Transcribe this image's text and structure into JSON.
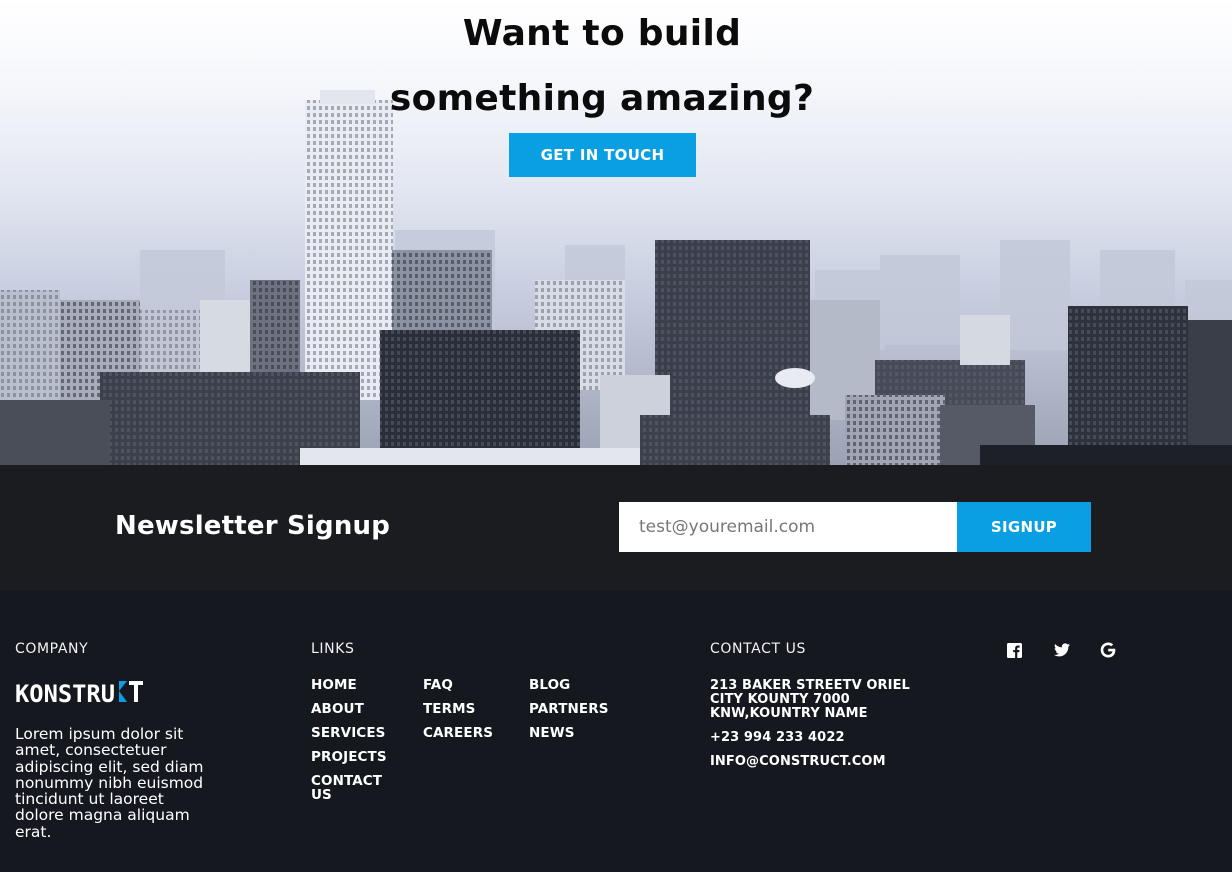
{
  "hero": {
    "title_line1": "Want to build",
    "title_line2": "something amazing?",
    "cta_label": "GET IN TOUCH"
  },
  "newsletter": {
    "title": "Newsletter Signup",
    "placeholder": "test@youremail.com",
    "button_label": "SIGNUP"
  },
  "footer": {
    "company": {
      "heading": "COMPANY",
      "logo_text": "KONSTRUCT",
      "description": "Lorem ipsum dolor sit amet, consectetuer adipiscing elit, sed diam nonummy nibh euismod tincidunt ut laoreet dolore magna aliquam erat."
    },
    "links": {
      "heading": "LINKS",
      "col1": [
        "HOME",
        "ABOUT",
        "SERVICES",
        "PROJECTS",
        "CONTACT US"
      ],
      "col2": [
        "FAQ",
        "TERMS",
        "CAREERS"
      ],
      "col3": [
        "BLOG",
        "PARTNERS",
        "NEWS"
      ]
    },
    "contact": {
      "heading": "CONTACT US",
      "address_line1": "213 BAKER STREETV ORIEL",
      "address_line2": "CITY KOUNTY 7000",
      "address_line3": "KNW,KOUNTRY NAME",
      "phone": "+23 994 233 4022",
      "email": "INFO@CONSTRUCT.COM"
    },
    "social": [
      "facebook-icon",
      "twitter-icon",
      "google-icon"
    ]
  },
  "colors": {
    "accent": "#0a9fe2",
    "newsletter_bg": "#1a1c1f",
    "footer_bg": "#15181f"
  }
}
